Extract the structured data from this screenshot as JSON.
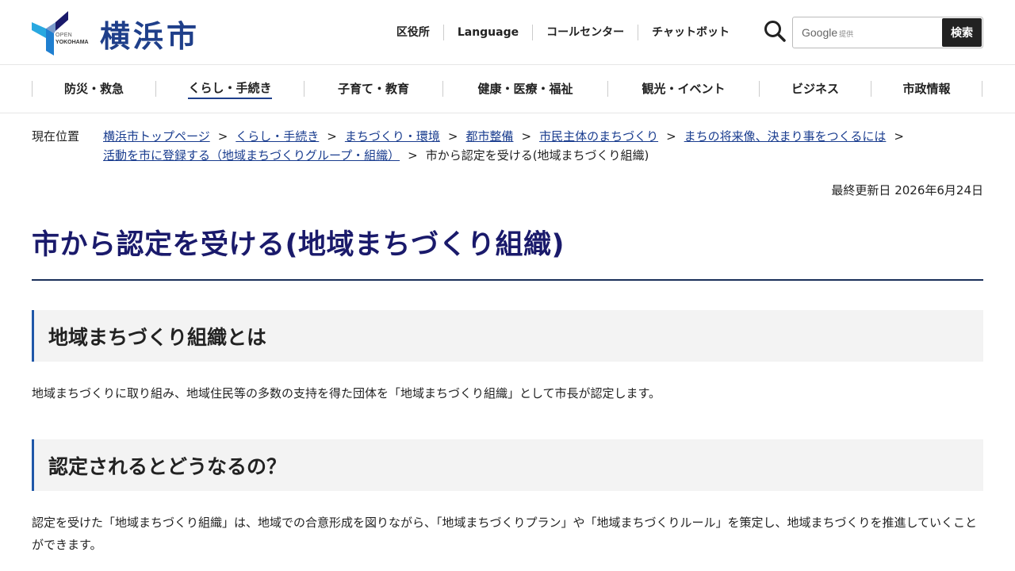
{
  "header": {
    "logo_text": "横浜市",
    "logo_open": "OPEN",
    "logo_yokohama": "YOKOHAMA",
    "util_nav": [
      "区役所",
      "Language",
      "コールセンター",
      "チャットボット"
    ],
    "search": {
      "brand": "Google",
      "brand_sub": "提供",
      "button_label": "検索"
    }
  },
  "gnav": {
    "items": [
      "防災・救急",
      "くらし・手続き",
      "子育て・教育",
      "健康・医療・福祉",
      "観光・イベント",
      "ビジネス",
      "市政情報"
    ],
    "active_index": 1
  },
  "breadcrumb": {
    "label": "現在位置",
    "separator": ">",
    "links": [
      "横浜市トップページ",
      "くらし・手続き",
      "まちづくり・環境",
      "都市整備",
      "市民主体のまちづくり",
      "まちの将来像、決まり事をつくるには",
      "活動を市に登録する（地域まちづくりグループ・組織）"
    ],
    "current": "市から認定を受ける(地域まちづくり組織)"
  },
  "updated": "最終更新日 2026年6月24日",
  "page_title": "市から認定を受ける(地域まちづくり組織)",
  "sections": [
    {
      "heading": "地域まちづくり組織とは",
      "body": "地域まちづくりに取り組み、地域住民等の多数の支持を得た団体を「地域まちづくり組織」として市長が認定します。"
    },
    {
      "heading": "認定されるとどうなるの？",
      "body": "認定を受けた「地域まちづくり組織」は、地域での合意形成を図りながら、「地域まちづくりプラン」や「地域まちづくりルール」を策定し、地域まちづくりを推進していくことができます。"
    }
  ],
  "colors": {
    "brand_blue": "#1f3f8a",
    "title_navy": "#1a1a6b",
    "link": "#1a3d8f",
    "heading_accent": "#1f57a8",
    "logo_cyan": "#29a8e0"
  }
}
